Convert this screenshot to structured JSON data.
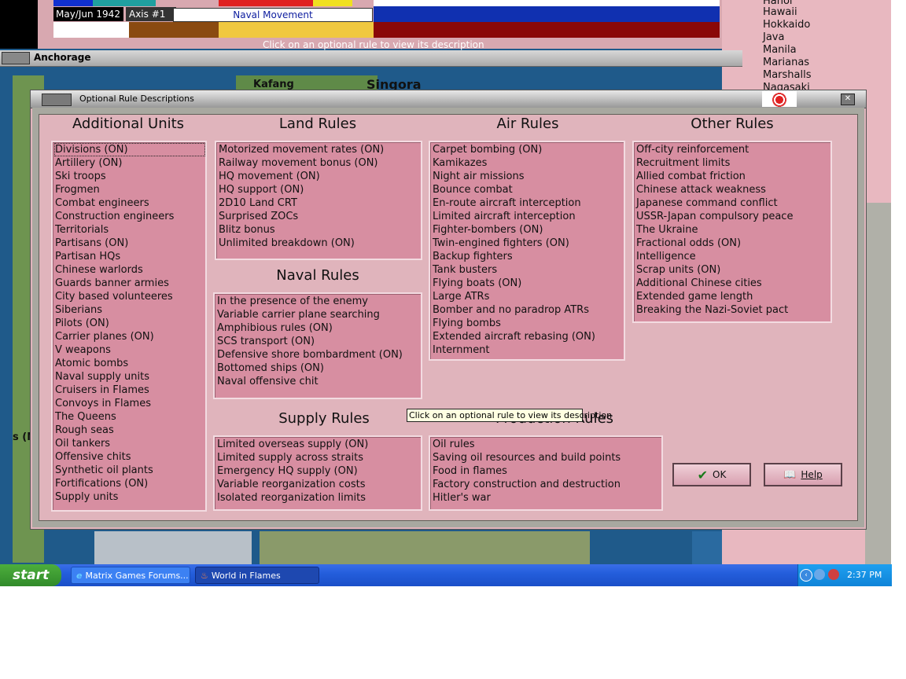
{
  "status_panel": {
    "date": "May/Jun 1942",
    "phase": "Axis #1",
    "action": "Naval Movement",
    "hint": "Click on an optional rule to view its description"
  },
  "background_window": {
    "title": "Anchorage",
    "map_labels": [
      "Kafang",
      "Singora",
      "s (N"
    ]
  },
  "right_list": [
    "Hanoi",
    "Hawaii",
    "Hokkaido",
    "Java",
    "Manila",
    "Marianas",
    "Marshalls",
    "Nagasaki"
  ],
  "dialog": {
    "title": "Optional Rule Descriptions",
    "sections": {
      "additional_units": {
        "heading": "Additional Units",
        "items": [
          "Divisions (ON)",
          "Artillery (ON)",
          "Ski troops",
          "Frogmen",
          "Combat engineers",
          "Construction engineers",
          "Territorials",
          "Partisans (ON)",
          "Partisan HQs",
          "Chinese warlords",
          "Guards banner armies",
          "City based volunteeres",
          "Siberians",
          "Pilots (ON)",
          "Carrier planes (ON)",
          "V weapons",
          "Atomic bombs",
          "Naval supply units",
          "Cruisers in Flames",
          "Convoys in Flames",
          "The Queens",
          "Rough seas",
          "Oil tankers",
          "Offensive chits",
          "Synthetic oil plants",
          "Fortifications (ON)",
          "Supply units"
        ]
      },
      "land_rules": {
        "heading": "Land Rules",
        "items": [
          "Motorized movement rates (ON)",
          "Railway movement bonus (ON)",
          "HQ movement (ON)",
          "HQ support (ON)",
          "2D10 Land CRT",
          "Surprised ZOCs",
          "Blitz bonus",
          "Unlimited breakdown (ON)"
        ]
      },
      "naval_rules": {
        "heading": "Naval Rules",
        "items": [
          "In the presence of the enemy",
          "Variable carrier plane searching",
          "Amphibious rules (ON)",
          "SCS transport (ON)",
          "Defensive shore bombardment (ON)",
          "Bottomed ships (ON)",
          "Naval offensive chit"
        ]
      },
      "supply_rules": {
        "heading": "Supply Rules",
        "items": [
          "Limited overseas supply (ON)",
          "Limited supply across straits",
          "Emergency HQ supply (ON)",
          "Variable reorganization costs",
          "Isolated reorganization limits"
        ]
      },
      "air_rules": {
        "heading": "Air Rules",
        "items": [
          "Carpet bombing (ON)",
          "Kamikazes",
          "Night air missions",
          "Bounce combat",
          "En-route aircraft interception",
          "Limited aircraft interception",
          "Fighter-bombers (ON)",
          "Twin-engined fighters (ON)",
          "Backup fighters",
          "Tank busters",
          "Flying boats (ON)",
          "Large ATRs",
          "Bomber and no paradrop ATRs",
          "Flying bombs",
          "Extended aircraft rebasing (ON)",
          "Internment"
        ]
      },
      "production_rules": {
        "heading": "Production Rules",
        "items": [
          "Oil rules",
          "Saving oil resources and build points",
          "Food in flames",
          "Factory construction and destruction",
          "Hitler's war"
        ]
      },
      "other_rules": {
        "heading": "Other Rules",
        "items": [
          "Off-city reinforcement",
          "Recruitment limits",
          "Allied combat friction",
          "Chinese attack weakness",
          "Japanese command conflict",
          "USSR-Japan compulsory peace",
          "The Ukraine",
          "Fractional odds (ON)",
          "Intelligence",
          "Scrap units (ON)",
          "Additional Chinese cities",
          "Extended game length",
          "Breaking the Nazi-Soviet pact"
        ]
      }
    },
    "ok_label": "OK",
    "help_label": "Help",
    "tooltip": "Click on an optional rule to view its description"
  },
  "taskbar": {
    "start_label": "start",
    "tasks": [
      "Matrix Games Forums...",
      "World in Flames"
    ],
    "clock": "2:37 PM"
  },
  "colors": {
    "dialog_bg": "#e0b4bc",
    "list_bg": "#d78ea1",
    "taskbar_blue": "#245edc",
    "start_green": "#3a9a32"
  }
}
